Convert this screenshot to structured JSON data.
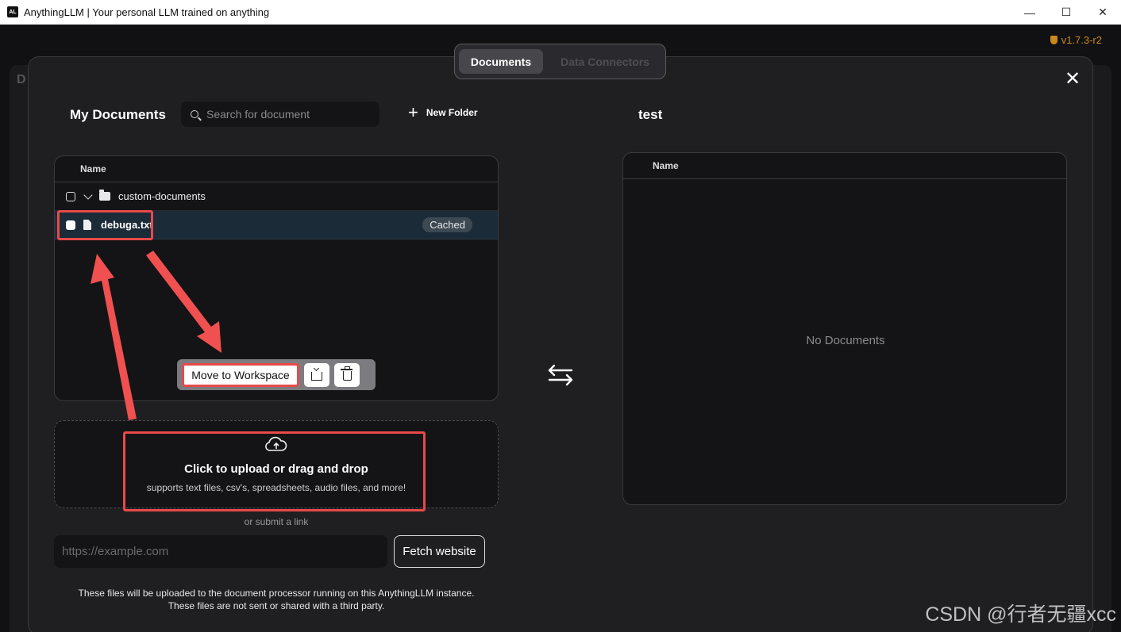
{
  "window": {
    "app_icon": "AL",
    "title": "AnythingLLM | Your personal LLM trained on anything",
    "minimize": "—",
    "maximize": "☐",
    "close": "✕"
  },
  "app": {
    "version": "v1.7.3-r2",
    "bg_letter": "D"
  },
  "modal": {
    "tabs": [
      {
        "label": "Documents",
        "active": true
      },
      {
        "label": "Data Connectors",
        "active": false
      }
    ],
    "close": "✕"
  },
  "my_documents": {
    "title": "My Documents",
    "search_placeholder": "Search for document",
    "new_folder_label": "New Folder",
    "column_name": "Name",
    "folder": {
      "name": "custom-documents"
    },
    "file": {
      "name": "debuga.txt",
      "badge": "Cached"
    }
  },
  "actions": {
    "move_label": "Move to Workspace"
  },
  "upload": {
    "title": "Click to upload or drag and drop",
    "subtitle": "supports text files, csv's, spreadsheets, audio files, and more!",
    "or_link": "or submit a link",
    "url_placeholder": "https://example.com",
    "fetch_label": "Fetch website",
    "disclaimer_1": "These files will be uploaded to the document processor running on this AnythingLLM instance.",
    "disclaimer_2": "These files are not sent or shared with a third party."
  },
  "workspace": {
    "title": "test",
    "column_name": "Name",
    "empty_text": "No Documents"
  },
  "watermark": "CSDN @行者无疆xcc",
  "colors": {
    "highlight": "#e84a4a",
    "version": "#c98a1b",
    "selected_row": "#1b2b38"
  }
}
